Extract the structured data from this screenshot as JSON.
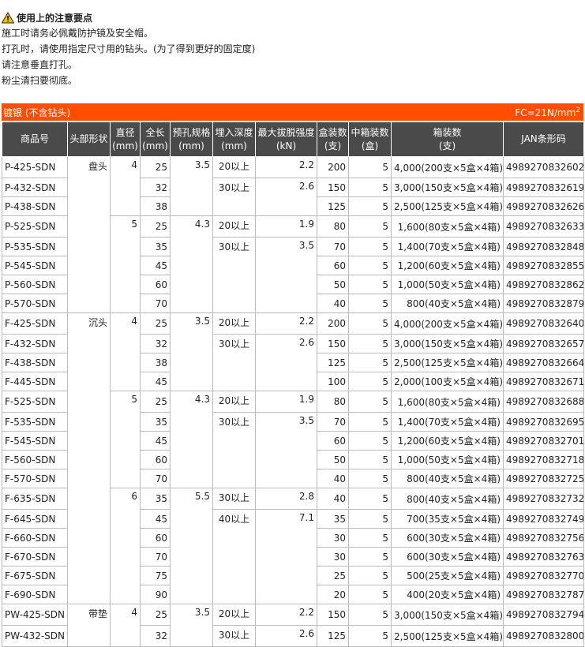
{
  "notice": {
    "title": "使用上的注意要点",
    "lines": [
      "施工时请务必佩戴防护镜及安全帽。",
      "打孔时，请使用指定尺寸用的钻头。(为了得到更好的固定度)",
      "请注意垂直打孔。",
      "粉尘清扫要彻底。"
    ]
  },
  "banner": {
    "left": "镀银 (不含钻头)",
    "right": "FC=21N/mm",
    "right_sup": "2"
  },
  "colors": {
    "banner": "#ff4e00",
    "header": "#4a4a4a"
  },
  "icons": {
    "notice": "warning-icon"
  },
  "headers": {
    "product": "商品号",
    "head": "头部形状",
    "dia": [
      "直径",
      "(mm)"
    ],
    "len": [
      "全长",
      "(mm)"
    ],
    "hole": [
      "预孔规格",
      "(mm)"
    ],
    "depth": [
      "埋入深度",
      "(mm)"
    ],
    "force": [
      "最大拔脱强度",
      "(kN)"
    ],
    "box": [
      "盒装数",
      "(支)"
    ],
    "mid": [
      "中箱装数",
      "(盒)"
    ],
    "case": [
      "箱装数",
      "(支)"
    ],
    "jan": "JAN条形码"
  },
  "rows": [
    {
      "product": "P-425-SDN",
      "head": "盘头",
      "dia": "4",
      "len": "25",
      "hole": "3.5",
      "depth": "20以上",
      "force": "2.2",
      "box": "200",
      "mid": "5",
      "case": "4,000(200支×5盒×4箱)",
      "jan": "4989270832602"
    },
    {
      "product": "P-432-SDN",
      "len": "32",
      "depth": "30以上",
      "force": "2.6",
      "box": "150",
      "mid": "5",
      "case": "3,000(150支×5盒×4箱)",
      "jan": "4989270832619"
    },
    {
      "product": "P-438-SDN",
      "len": "38",
      "box": "125",
      "mid": "5",
      "case": "2,500(125支×5盒×4箱)",
      "jan": "4989270832626"
    },
    {
      "product": "P-525-SDN",
      "dia": "5",
      "len": "25",
      "hole": "4.3",
      "depth": "20以上",
      "force": "1.9",
      "box": "80",
      "mid": "5",
      "case": "1,600(80支×5盒×4箱)",
      "jan": "4989270832633"
    },
    {
      "product": "P-535-SDN",
      "len": "35",
      "depth": "30以上",
      "force": "3.5",
      "box": "70",
      "mid": "5",
      "case": "1,400(70支×5盒×4箱)",
      "jan": "4989270832848"
    },
    {
      "product": "P-545-SDN",
      "len": "45",
      "box": "60",
      "mid": "5",
      "case": "1,200(60支×5盒×4箱)",
      "jan": "4989270832855"
    },
    {
      "product": "P-560-SDN",
      "len": "60",
      "box": "50",
      "mid": "5",
      "case": "1,000(50支×5盒×4箱)",
      "jan": "4989270832862"
    },
    {
      "product": "P-570-SDN",
      "len": "70",
      "box": "40",
      "mid": "5",
      "case": "800(40支×5盒×4箱)",
      "jan": "4989270832879"
    },
    {
      "product": "F-425-SDN",
      "head": "沉头",
      "dia": "4",
      "len": "25",
      "hole": "3.5",
      "depth": "20以上",
      "force": "2.2",
      "box": "200",
      "mid": "5",
      "case": "4,000(200支×5盒×4箱)",
      "jan": "4989270832640"
    },
    {
      "product": "F-432-SDN",
      "len": "32",
      "depth": "30以上",
      "force": "2.6",
      "box": "150",
      "mid": "5",
      "case": "3,000(150支×5盒×4箱)",
      "jan": "4989270832657"
    },
    {
      "product": "F-438-SDN",
      "len": "38",
      "box": "125",
      "mid": "5",
      "case": "2,500(125支×5盒×4箱)",
      "jan": "4989270832664"
    },
    {
      "product": "F-445-SDN",
      "len": "45",
      "box": "100",
      "mid": "5",
      "case": "2,000(100支×5盒×4箱)",
      "jan": "4989270832671"
    },
    {
      "product": "F-525-SDN",
      "dia": "5",
      "len": "25",
      "hole": "4.3",
      "depth": "20以上",
      "force": "1.9",
      "box": "80",
      "mid": "5",
      "case": "1,600(80支×5盒×4箱)",
      "jan": "4989270832688"
    },
    {
      "product": "F-535-SDN",
      "len": "35",
      "depth": "30以上",
      "force": "3.5",
      "box": "70",
      "mid": "5",
      "case": "1,400(70支×5盒×4箱)",
      "jan": "4989270832695"
    },
    {
      "product": "F-545-SDN",
      "len": "45",
      "box": "60",
      "mid": "5",
      "case": "1,200(60支×5盒×4箱)",
      "jan": "4989270832701"
    },
    {
      "product": "F-560-SDN",
      "len": "60",
      "box": "50",
      "mid": "5",
      "case": "1,000(50支×5盒×4箱)",
      "jan": "4989270832718"
    },
    {
      "product": "F-570-SDN",
      "len": "70",
      "box": "40",
      "mid": "5",
      "case": "800(40支×5盒×4箱)",
      "jan": "4989270832725"
    },
    {
      "product": "F-635-SDN",
      "dia": "6",
      "len": "35",
      "hole": "5.5",
      "depth": "30以上",
      "force": "2.8",
      "box": "40",
      "mid": "5",
      "case": "800(40支×5盒×4箱)",
      "jan": "4989270832732"
    },
    {
      "product": "F-645-SDN",
      "len": "45",
      "depth": "40以上",
      "force": "7.1",
      "box": "35",
      "mid": "5",
      "case": "700(35支×5盒×4箱)",
      "jan": "4989270832749"
    },
    {
      "product": "F-660-SDN",
      "len": "60",
      "box": "30",
      "mid": "5",
      "case": "600(30支×5盒×4箱)",
      "jan": "4989270832756"
    },
    {
      "product": "F-670-SDN",
      "len": "70",
      "box": "30",
      "mid": "5",
      "case": "600(30支×5盒×4箱)",
      "jan": "4989270832763"
    },
    {
      "product": "F-675-SDN",
      "len": "75",
      "box": "25",
      "mid": "5",
      "case": "500(25支×5盒×4箱)",
      "jan": "4989270832770"
    },
    {
      "product": "F-690-SDN",
      "len": "90",
      "box": "20",
      "mid": "5",
      "case": "400(20支×5盒×4箱)",
      "jan": "4989270832787"
    },
    {
      "product": "PW-425-SDN",
      "head": "带垫",
      "dia": "4",
      "len": "25",
      "hole": "3.5",
      "depth": "20以上",
      "force": "2.2",
      "box": "150",
      "mid": "5",
      "case": "3,000(150支×5盒×4箱)",
      "jan": "4989270832794"
    },
    {
      "product": "PW-432-SDN",
      "len": "32",
      "depth": "30以上",
      "force": "2.6",
      "box": "125",
      "mid": "5",
      "case": "2,500(125支×5盒×4箱)",
      "jan": "4989270832800"
    }
  ]
}
